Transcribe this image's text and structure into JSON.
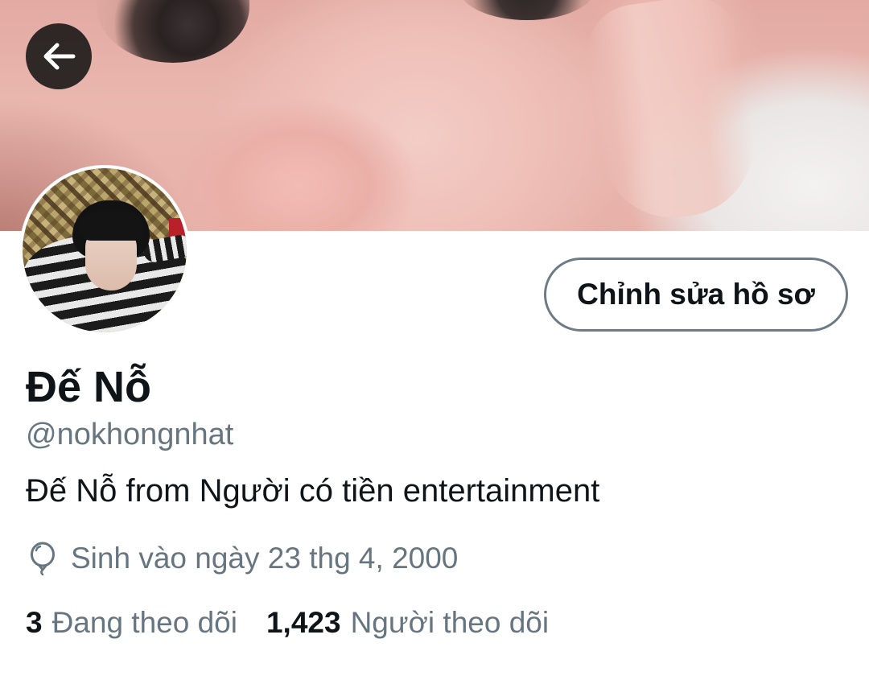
{
  "profile": {
    "display_name": "Đế Nỗ",
    "handle": "@nokhongnhat",
    "bio": "Đế Nỗ from Người có tiền entertainment",
    "birth_text": "Sinh vào ngày 23 thg 4, 2000",
    "edit_button_label": "Chỉnh sửa hồ sơ",
    "following_count": "3",
    "following_label": "Đang theo dõi",
    "followers_count": "1,423",
    "followers_label": "Người theo dõi"
  },
  "icons": {
    "back": "arrow-left-icon",
    "birth": "balloon-icon"
  },
  "colors": {
    "text_primary": "#0f1419",
    "text_secondary": "#66757f",
    "button_border": "#6e7b86",
    "back_button_bg": "#141414"
  }
}
